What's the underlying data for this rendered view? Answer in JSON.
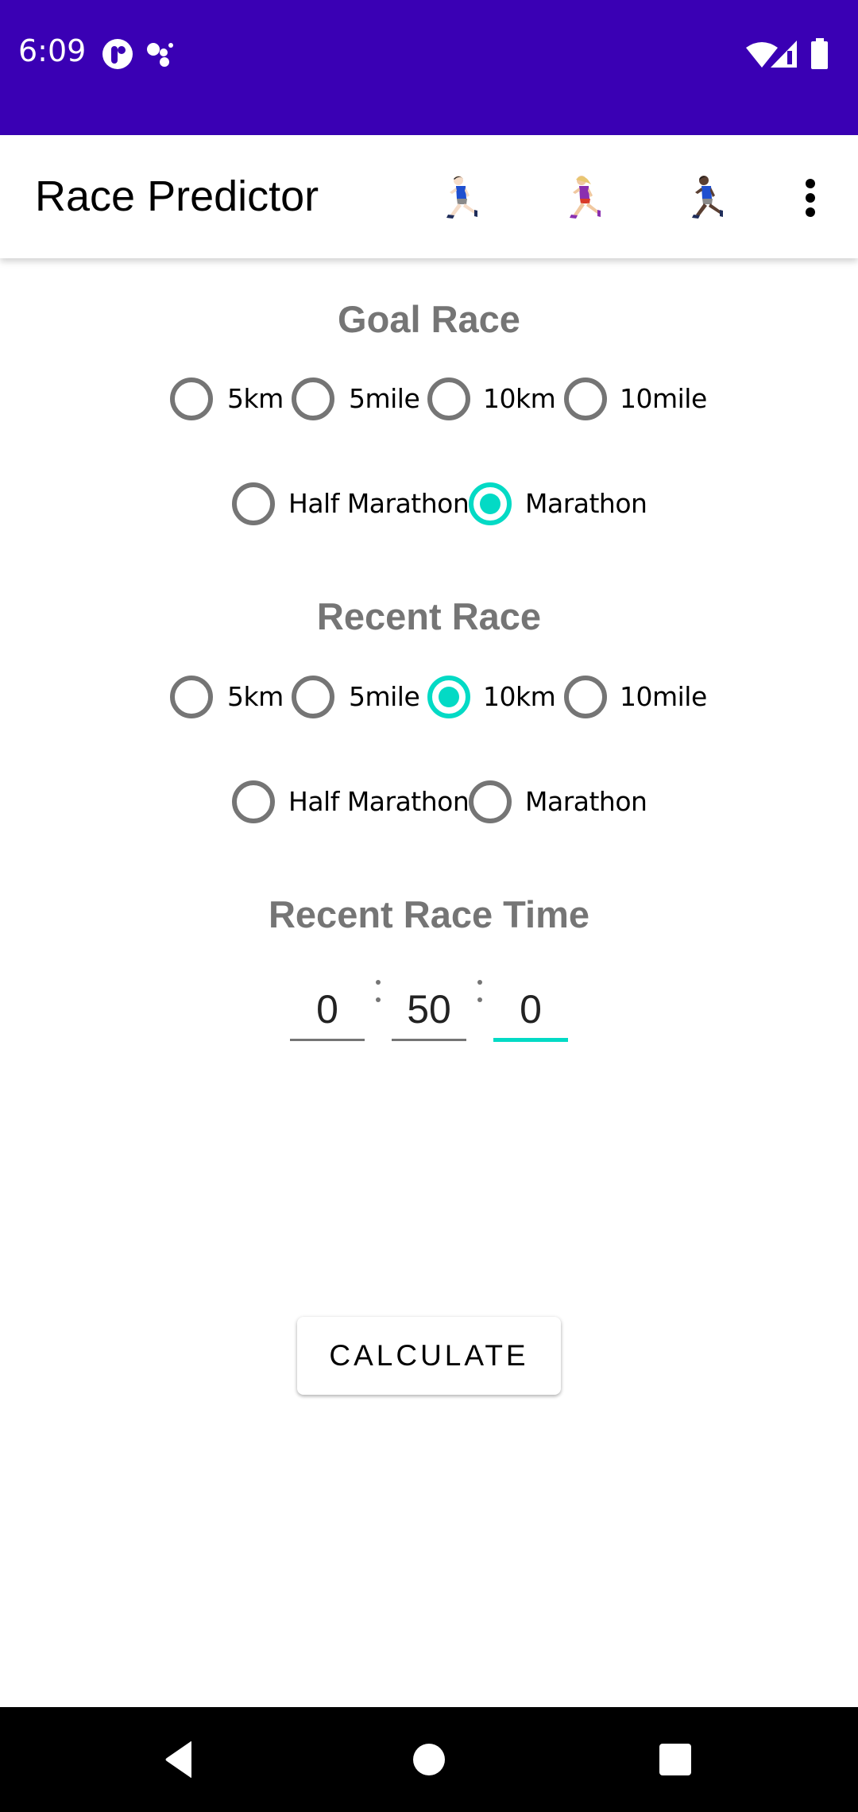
{
  "status_bar": {
    "time": "6:09",
    "left_icons": [
      "podcast-app-icon",
      "assistant-dots-icon"
    ],
    "right_icons": [
      "wifi-icon",
      "cell-signal-icon",
      "battery-icon"
    ],
    "color": "#3A00B4"
  },
  "app_bar": {
    "title": "Race Predictor",
    "actions": [
      {
        "name": "runner-light-skin-icon",
        "glyph": "🏃🏻"
      },
      {
        "name": "woman-runner-icon",
        "glyph": "🏃🏼‍♀️"
      },
      {
        "name": "runner-dark-skin-icon",
        "glyph": "🏃🏿"
      }
    ],
    "overflow_icon": "more-vert-icon"
  },
  "goal_race": {
    "heading": "Goal Race",
    "options": [
      "5km",
      "5mile",
      "10km",
      "10mile",
      "Half Marathon",
      "Marathon"
    ],
    "selected": "Marathon"
  },
  "recent_race": {
    "heading": "Recent Race",
    "options": [
      "5km",
      "5mile",
      "10km",
      "10mile",
      "Half Marathon",
      "Marathon"
    ],
    "selected": "10km"
  },
  "recent_race_time": {
    "heading": "Recent Race Time",
    "hours": "0",
    "minutes": "50",
    "seconds": "0",
    "focused_field": "seconds"
  },
  "calculate_button": {
    "label": "CALCULATE"
  },
  "nav_bar": {
    "buttons": [
      "back-icon",
      "home-icon",
      "recents-icon"
    ]
  },
  "colors": {
    "accent": "#03DAC5",
    "heading_gray": "#757575",
    "primary_dark": "#3A00B4"
  }
}
